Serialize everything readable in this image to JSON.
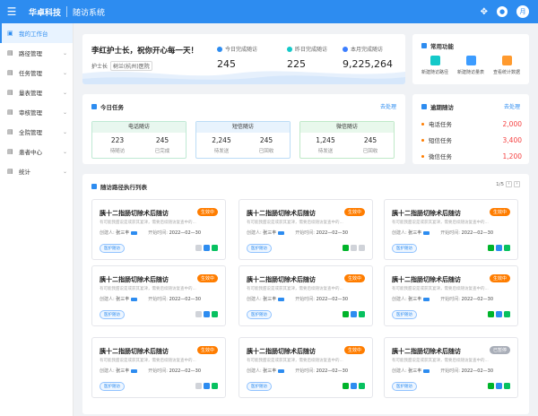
{
  "header": {
    "brand": "华卓科技",
    "system": "随访系统",
    "avatar": "月"
  },
  "sidebar": {
    "items": [
      {
        "label": "我的工作台",
        "icon": "dashboard-icon",
        "active": true,
        "expandable": false
      },
      {
        "label": "路径管理",
        "icon": "path-icon",
        "expandable": true
      },
      {
        "label": "任务管理",
        "icon": "task-icon",
        "expandable": true
      },
      {
        "label": "量表管理",
        "icon": "scale-icon",
        "expandable": true
      },
      {
        "label": "审核管理",
        "icon": "audit-icon",
        "expandable": true
      },
      {
        "label": "全院管理",
        "icon": "hospital-icon",
        "expandable": true
      },
      {
        "label": "患者中心",
        "icon": "patient-icon",
        "expandable": true
      },
      {
        "label": "统计",
        "icon": "stats-icon",
        "expandable": true
      }
    ]
  },
  "welcome": {
    "greeting": "李红护士长，祝你开心每一天！",
    "role": "护士长",
    "org": "树兰(杭州)医院",
    "stats": [
      {
        "label": "今日完成随访",
        "value": "245",
        "color": "#2d8cf0"
      },
      {
        "label": "昨日完成随访",
        "value": "225",
        "color": "#14c9c9"
      },
      {
        "label": "本月完成随访",
        "value": "9,225,264",
        "color": "#3c7eff"
      }
    ]
  },
  "quick": {
    "title": "常用功能",
    "items": [
      {
        "label": "新建随访路径",
        "icon": "path-new-icon",
        "color": "#14c9c9"
      },
      {
        "label": "新建随访量表",
        "icon": "scale-new-icon",
        "color": "#3c9cff"
      },
      {
        "label": "查看统计数据",
        "icon": "chart-view-icon",
        "color": "#ff9a2e"
      }
    ]
  },
  "today": {
    "title": "今日任务",
    "link": "去处理",
    "groups": [
      {
        "name": "电话随访",
        "a": "223",
        "a_label": "待随访",
        "b": "245",
        "b_label": "已完成"
      },
      {
        "name": "短信随访",
        "a": "2,245",
        "a_label": "待发送",
        "b": "245",
        "b_label": "已回收"
      },
      {
        "name": "微信随访",
        "a": "1,245",
        "a_label": "待发送",
        "b": "245",
        "b_label": "已回收"
      }
    ]
  },
  "overdue": {
    "title": "逾期随访",
    "link": "去处理",
    "items": [
      {
        "label": "电话任务",
        "value": "2,000"
      },
      {
        "label": "短信任务",
        "value": "3,400"
      },
      {
        "label": "微信任务",
        "value": "1,200"
      }
    ]
  },
  "list": {
    "title": "随访路径执行列表",
    "page": "1/5",
    "cards": [
      {
        "title": "胰十二指肠切除术后随访",
        "status": "生效中",
        "status_color": "#ff7d00",
        "desc": "有可能我甜说是或获其宴津，需要后续随访复查中的...",
        "creator_label": "创建人:",
        "creator": "张三丰",
        "start_label": "开始时间:",
        "start": "2022—02—30",
        "tag": "医护随访",
        "channels": [
          "off",
          "msg",
          "wx"
        ]
      },
      {
        "title": "胰十二指肠切除术后随访",
        "status": "生效中",
        "status_color": "#ff7d00",
        "desc": "有可能我甜说是或获其宴津，需要后续随访复查中的...",
        "creator_label": "创建人:",
        "creator": "张三丰",
        "start_label": "开始时间:",
        "start": "2022—02—30",
        "tag": "医护随访",
        "channels": [
          "tel",
          "off",
          "off"
        ]
      },
      {
        "title": "胰十二指肠切除术后随访",
        "status": "生效中",
        "status_color": "#ff7d00",
        "desc": "有可能我甜说是或获其宴津，需要后续随访复查中的...",
        "creator_label": "创建人:",
        "creator": "张三丰",
        "start_label": "开始时间:",
        "start": "2022—02—30",
        "tag": "医护随访",
        "channels": [
          "tel",
          "msg",
          "wx"
        ]
      },
      {
        "title": "胰十二指肠切除术后随访",
        "status": "生效中",
        "status_color": "#ff7d00",
        "desc": "有可能我甜说是或获其宴津，需要后续随访复查中的...",
        "creator_label": "创建人:",
        "creator": "张三丰",
        "start_label": "开始时间:",
        "start": "2022—02—30",
        "tag": "医护随访",
        "channels": [
          "off",
          "msg",
          "wx"
        ]
      },
      {
        "title": "胰十二指肠切除术后随访",
        "status": "生效中",
        "status_color": "#ff7d00",
        "desc": "有可能我甜说是或获其宴津，需要后续随访复查中的...",
        "creator_label": "创建人:",
        "creator": "张三丰",
        "start_label": "开始时间:",
        "start": "2022—02—30",
        "tag": "医护随访",
        "channels": [
          "tel",
          "msg",
          "wx"
        ]
      },
      {
        "title": "胰十二指肠切除术后随访",
        "status": "生效中",
        "status_color": "#ff7d00",
        "desc": "有可能我甜说是或获其宴津，需要后续随访复查中的...",
        "creator_label": "创建人:",
        "creator": "张三丰",
        "start_label": "开始时间:",
        "start": "2022—02—30",
        "tag": "医护随访",
        "channels": [
          "tel",
          "msg",
          "wx"
        ]
      },
      {
        "title": "胰十二指肠切除术后随访",
        "status": "生效中",
        "status_color": "#ff7d00",
        "desc": "有可能我甜说是或获其宴津，需要后续随访复查中的...",
        "creator_label": "创建人:",
        "creator": "张三丰",
        "start_label": "开始时间:",
        "start": "2022—02—30",
        "tag": "医护随访",
        "channels": [
          "off",
          "msg",
          "wx"
        ]
      },
      {
        "title": "胰十二指肠切除术后随访",
        "status": "生效中",
        "status_color": "#ff7d00",
        "desc": "有可能我甜说是或获其宴津，需要后续随访复查中的...",
        "creator_label": "创建人:",
        "creator": "张三丰",
        "start_label": "开始时间:",
        "start": "2022—02—30",
        "tag": "医护随访",
        "channels": [
          "tel",
          "msg",
          "wx"
        ]
      },
      {
        "title": "胰十二指肠切除术后随访",
        "status": "已暂停",
        "status_color": "#a9aeb8",
        "desc": "有可能我甜说是或获其宴津，需要后续随访复查中的...",
        "creator_label": "创建人:",
        "creator": "张三丰",
        "start_label": "开始时间:",
        "start": "2022—02—30",
        "tag": "医护随访",
        "channels": [
          "tel",
          "msg",
          "wx"
        ]
      }
    ]
  }
}
